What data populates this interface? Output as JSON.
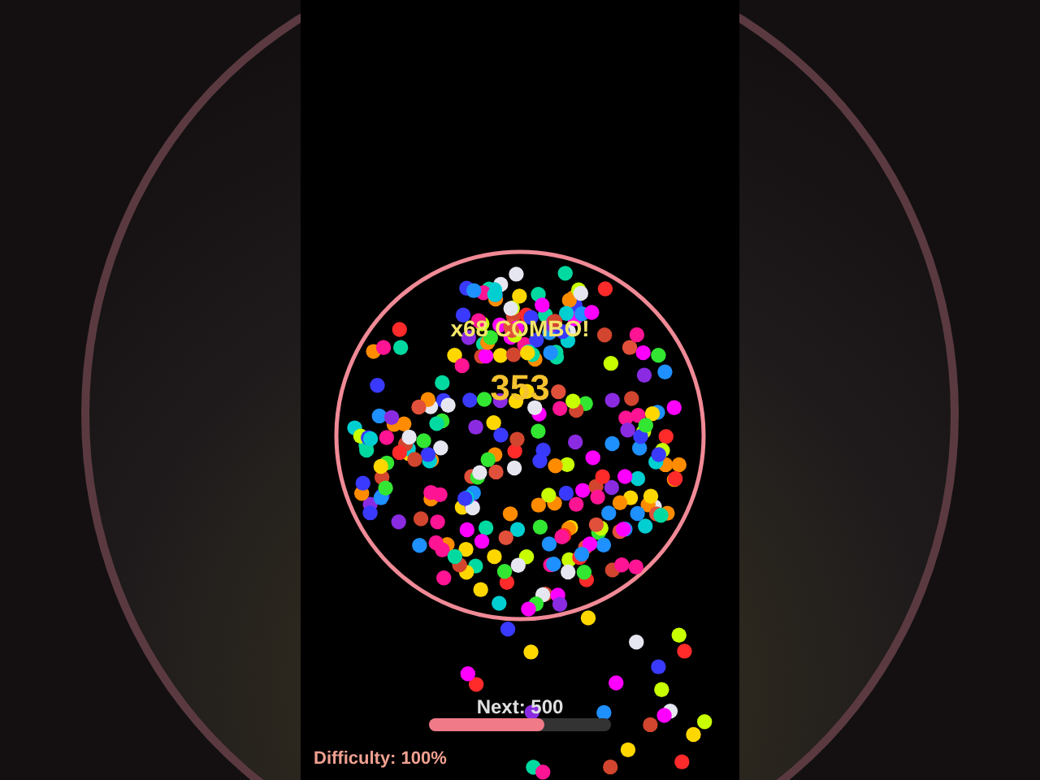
{
  "combo": "x68 COMBO!",
  "score": "353",
  "next": {
    "label": "Next: 500",
    "level": 0.63
  },
  "difficulty": "Difficulty: 100%"
}
